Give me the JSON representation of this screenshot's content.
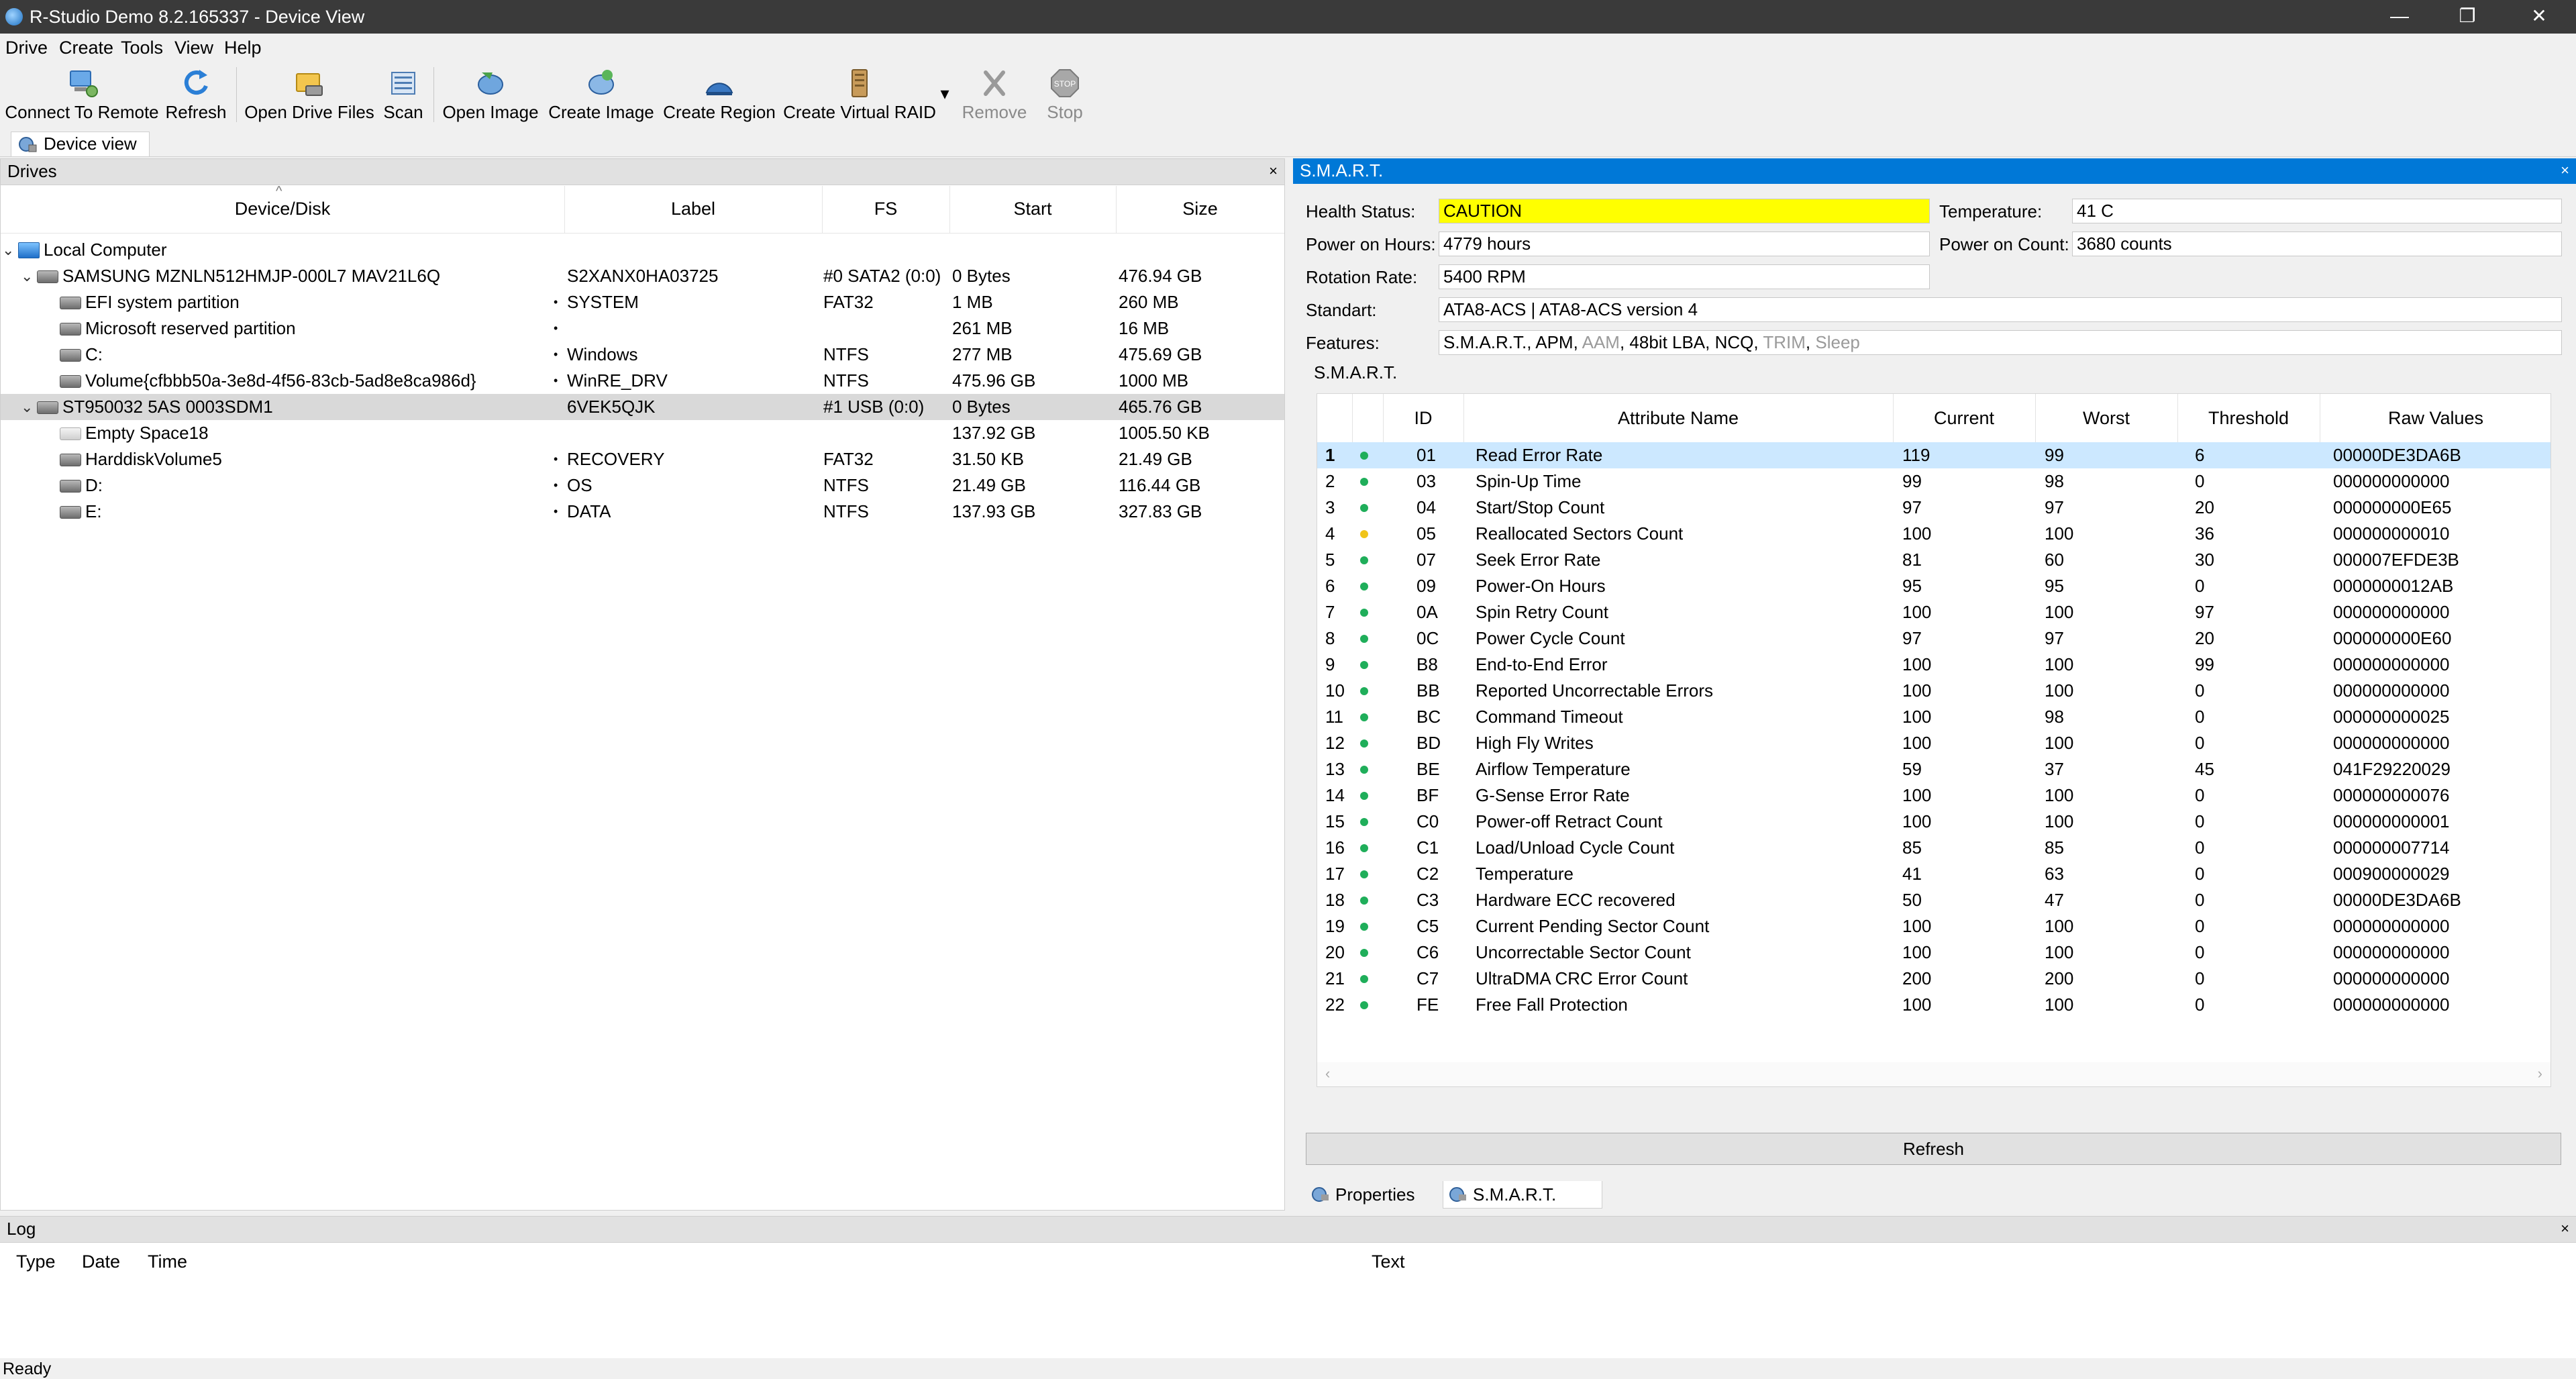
{
  "window": {
    "title": "R-Studio Demo 8.2.165337 - Device View",
    "minimize": "—",
    "maximize": "❐",
    "close": "✕"
  },
  "menu": [
    "Drive",
    "Create",
    "Tools",
    "View",
    "Help"
  ],
  "toolbar": {
    "connect": "Connect To Remote",
    "refresh": "Refresh",
    "open_drive_files": "Open Drive Files",
    "scan": "Scan",
    "open_image": "Open Image",
    "create_image": "Create Image",
    "create_region": "Create Region",
    "create_virtual_raid": "Create Virtual RAID",
    "remove": "Remove",
    "stop": "Stop",
    "stop_icon_text": "STOP",
    "dropdown": "▾"
  },
  "doc_tab": "Device view",
  "drives": {
    "title": "Drives",
    "close": "×",
    "sort_indicator": "^",
    "columns": {
      "device": "Device/Disk",
      "label": "Label",
      "fs": "FS",
      "start": "Start",
      "size": "Size"
    },
    "rows": [
      {
        "name": "Local Computer",
        "label": "",
        "fs": "",
        "start": "",
        "size": "",
        "chev": "⌄",
        "dot": ""
      },
      {
        "name": "SAMSUNG MZNLN512HMJP-000L7 MAV21L6Q",
        "label": "S2XANX0HA03725",
        "fs": "#0 SATA2 (0:0)",
        "start": "0 Bytes",
        "size": "476.94 GB",
        "chev": "⌄",
        "dot": ""
      },
      {
        "name": "EFI system partition",
        "label": "SYSTEM",
        "fs": "FAT32",
        "start": "1 MB",
        "size": "260 MB",
        "chev": "",
        "dot": "•"
      },
      {
        "name": "Microsoft reserved partition",
        "label": "",
        "fs": "",
        "start": "261 MB",
        "size": "16 MB",
        "chev": "",
        "dot": "•"
      },
      {
        "name": "C:",
        "label": "Windows",
        "fs": "NTFS",
        "start": "277 MB",
        "size": "475.69 GB",
        "chev": "",
        "dot": "•"
      },
      {
        "name": "Volume{cfbbb50a-3e8d-4f56-83cb-5ad8e8ca986d}",
        "label": "WinRE_DRV",
        "fs": "NTFS",
        "start": "475.96 GB",
        "size": "1000 MB",
        "chev": "",
        "dot": "•"
      },
      {
        "name": "ST950032 5AS 0003SDM1",
        "label": "6VEK5QJK",
        "fs": "#1 USB (0:0)",
        "start": "0 Bytes",
        "size": "465.76 GB",
        "chev": "⌄",
        "dot": ""
      },
      {
        "name": "Empty Space18",
        "label": "",
        "fs": "",
        "start": "137.92 GB",
        "size": "1005.50 KB",
        "chev": "",
        "dot": ""
      },
      {
        "name": "HarddiskVolume5",
        "label": "RECOVERY",
        "fs": "FAT32",
        "start": "31.50 KB",
        "size": "21.49 GB",
        "chev": "",
        "dot": "•"
      },
      {
        "name": "D:",
        "label": "OS",
        "fs": "NTFS",
        "start": "21.49 GB",
        "size": "116.44 GB",
        "chev": "",
        "dot": "•"
      },
      {
        "name": "E:",
        "label": "DATA",
        "fs": "NTFS",
        "start": "137.93 GB",
        "size": "327.83 GB",
        "chev": "",
        "dot": "•"
      }
    ]
  },
  "smart": {
    "title": "S.M.A.R.T.",
    "close": "×",
    "health_label": "Health Status:",
    "health_value": "CAUTION",
    "temp_label": "Temperature:",
    "temp_value": "41 C",
    "hours_label": "Power on Hours:",
    "hours_value": "4779 hours",
    "count_label": "Power on Count:",
    "count_value": "3680 counts",
    "rotation_label": "Rotation Rate:",
    "rotation_value": "5400 RPM",
    "standart_label": "Standart:",
    "standart_value": "ATA8-ACS | ATA8-ACS version 4",
    "features_label": "Features:",
    "features": [
      {
        "text": "S.M.A.R.T., ",
        "off": false
      },
      {
        "text": "APM, ",
        "off": false
      },
      {
        "text": "AAM",
        "off": true
      },
      {
        "text": ", ",
        "off": false
      },
      {
        "text": "48bit LBA, ",
        "off": false
      },
      {
        "text": "NCQ, ",
        "off": false
      },
      {
        "text": "TRIM",
        "off": true
      },
      {
        "text": ", ",
        "off": false
      },
      {
        "text": "Sleep",
        "off": true
      }
    ],
    "group_label": "S.M.A.R.T.",
    "columns": {
      "id": "ID",
      "name": "Attribute Name",
      "current": "Current",
      "worst": "Worst",
      "threshold": "Threshold",
      "raw": "Raw Values"
    },
    "status_colors": {
      "ok": "#1fae5a",
      "warn": "#f0c419"
    },
    "rows": [
      {
        "n": "1",
        "status": "ok",
        "id": "01",
        "name": "Read Error Rate",
        "current": "119",
        "worst": "99",
        "threshold": "6",
        "raw": "00000DE3DA6B"
      },
      {
        "n": "2",
        "status": "ok",
        "id": "03",
        "name": "Spin-Up Time",
        "current": "99",
        "worst": "98",
        "threshold": "0",
        "raw": "000000000000"
      },
      {
        "n": "3",
        "status": "ok",
        "id": "04",
        "name": "Start/Stop Count",
        "current": "97",
        "worst": "97",
        "threshold": "20",
        "raw": "000000000E65"
      },
      {
        "n": "4",
        "status": "warn",
        "id": "05",
        "name": "Reallocated Sectors Count",
        "current": "100",
        "worst": "100",
        "threshold": "36",
        "raw": "000000000010"
      },
      {
        "n": "5",
        "status": "ok",
        "id": "07",
        "name": "Seek Error Rate",
        "current": "81",
        "worst": "60",
        "threshold": "30",
        "raw": "000007EFDE3B"
      },
      {
        "n": "6",
        "status": "ok",
        "id": "09",
        "name": "Power-On Hours",
        "current": "95",
        "worst": "95",
        "threshold": "0",
        "raw": "0000000012AB"
      },
      {
        "n": "7",
        "status": "ok",
        "id": "0A",
        "name": "Spin Retry Count",
        "current": "100",
        "worst": "100",
        "threshold": "97",
        "raw": "000000000000"
      },
      {
        "n": "8",
        "status": "ok",
        "id": "0C",
        "name": "Power Cycle Count",
        "current": "97",
        "worst": "97",
        "threshold": "20",
        "raw": "000000000E60"
      },
      {
        "n": "9",
        "status": "ok",
        "id": "B8",
        "name": "End-to-End Error",
        "current": "100",
        "worst": "100",
        "threshold": "99",
        "raw": "000000000000"
      },
      {
        "n": "10",
        "status": "ok",
        "id": "BB",
        "name": "Reported Uncorrectable Errors",
        "current": "100",
        "worst": "100",
        "threshold": "0",
        "raw": "000000000000"
      },
      {
        "n": "11",
        "status": "ok",
        "id": "BC",
        "name": "Command Timeout",
        "current": "100",
        "worst": "98",
        "threshold": "0",
        "raw": "000000000025"
      },
      {
        "n": "12",
        "status": "ok",
        "id": "BD",
        "name": "High Fly Writes",
        "current": "100",
        "worst": "100",
        "threshold": "0",
        "raw": "000000000000"
      },
      {
        "n": "13",
        "status": "ok",
        "id": "BE",
        "name": "Airflow Temperature",
        "current": "59",
        "worst": "37",
        "threshold": "45",
        "raw": "041F29220029"
      },
      {
        "n": "14",
        "status": "ok",
        "id": "BF",
        "name": "G-Sense Error Rate",
        "current": "100",
        "worst": "100",
        "threshold": "0",
        "raw": "000000000076"
      },
      {
        "n": "15",
        "status": "ok",
        "id": "C0",
        "name": "Power-off Retract Count",
        "current": "100",
        "worst": "100",
        "threshold": "0",
        "raw": "000000000001"
      },
      {
        "n": "16",
        "status": "ok",
        "id": "C1",
        "name": "Load/Unload Cycle Count",
        "current": "85",
        "worst": "85",
        "threshold": "0",
        "raw": "000000007714"
      },
      {
        "n": "17",
        "status": "ok",
        "id": "C2",
        "name": "Temperature",
        "current": "41",
        "worst": "63",
        "threshold": "0",
        "raw": "000900000029"
      },
      {
        "n": "18",
        "status": "ok",
        "id": "C3",
        "name": "Hardware ECC recovered",
        "current": "50",
        "worst": "47",
        "threshold": "0",
        "raw": "00000DE3DA6B"
      },
      {
        "n": "19",
        "status": "ok",
        "id": "C5",
        "name": "Current Pending Sector Count",
        "current": "100",
        "worst": "100",
        "threshold": "0",
        "raw": "000000000000"
      },
      {
        "n": "20",
        "status": "ok",
        "id": "C6",
        "name": "Uncorrectable Sector Count",
        "current": "100",
        "worst": "100",
        "threshold": "0",
        "raw": "000000000000"
      },
      {
        "n": "21",
        "status": "ok",
        "id": "C7",
        "name": "UltraDMA CRC Error Count",
        "current": "200",
        "worst": "200",
        "threshold": "0",
        "raw": "000000000000"
      },
      {
        "n": "22",
        "status": "ok",
        "id": "FE",
        "name": "Free Fall Protection",
        "current": "100",
        "worst": "100",
        "threshold": "0",
        "raw": "000000000000"
      }
    ],
    "scroll_left": "‹",
    "scroll_right": "›",
    "refresh": "Refresh",
    "tabs": {
      "properties": "Properties",
      "smart": "S.M.A.R.T."
    }
  },
  "log": {
    "title": "Log",
    "close": "×",
    "columns": {
      "type": "Type",
      "date": "Date",
      "time": "Time",
      "text": "Text"
    }
  },
  "status": "Ready"
}
